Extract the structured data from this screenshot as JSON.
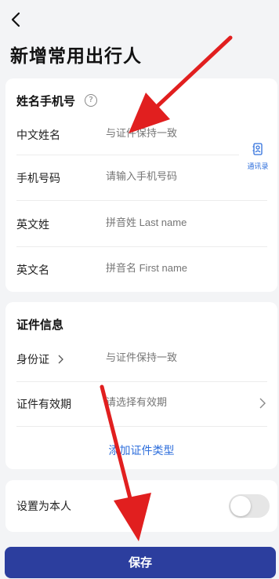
{
  "header": {
    "back_icon": "chevron-left-icon",
    "title": "新增常用出行人"
  },
  "name_section": {
    "title": "姓名手机号",
    "help_icon": "question-circle-icon",
    "fields": [
      {
        "label": "中文姓名",
        "placeholder": "与证件保持一致"
      },
      {
        "label": "手机号码",
        "placeholder": "请输入手机号码"
      },
      {
        "label": "英文姓",
        "placeholder": "拼音姓 Last name"
      },
      {
        "label": "英文名",
        "placeholder": "拼音名 First name"
      }
    ],
    "contacts_label": "通讯录",
    "contacts_icon": "address-book-icon"
  },
  "id_section": {
    "title": "证件信息",
    "id_type_label": "身份证",
    "id_placeholder": "与证件保持一致",
    "validity_label": "证件有效期",
    "validity_placeholder": "请选择有效期",
    "add_type_link": "添加证件类型"
  },
  "self_setting": {
    "label": "设置为本人",
    "toggle_on": false
  },
  "save_label": "保存",
  "colors": {
    "accent": "#2f6fdc",
    "save_button": "#2c3e9e",
    "annotation_arrow": "#e11f1f"
  }
}
